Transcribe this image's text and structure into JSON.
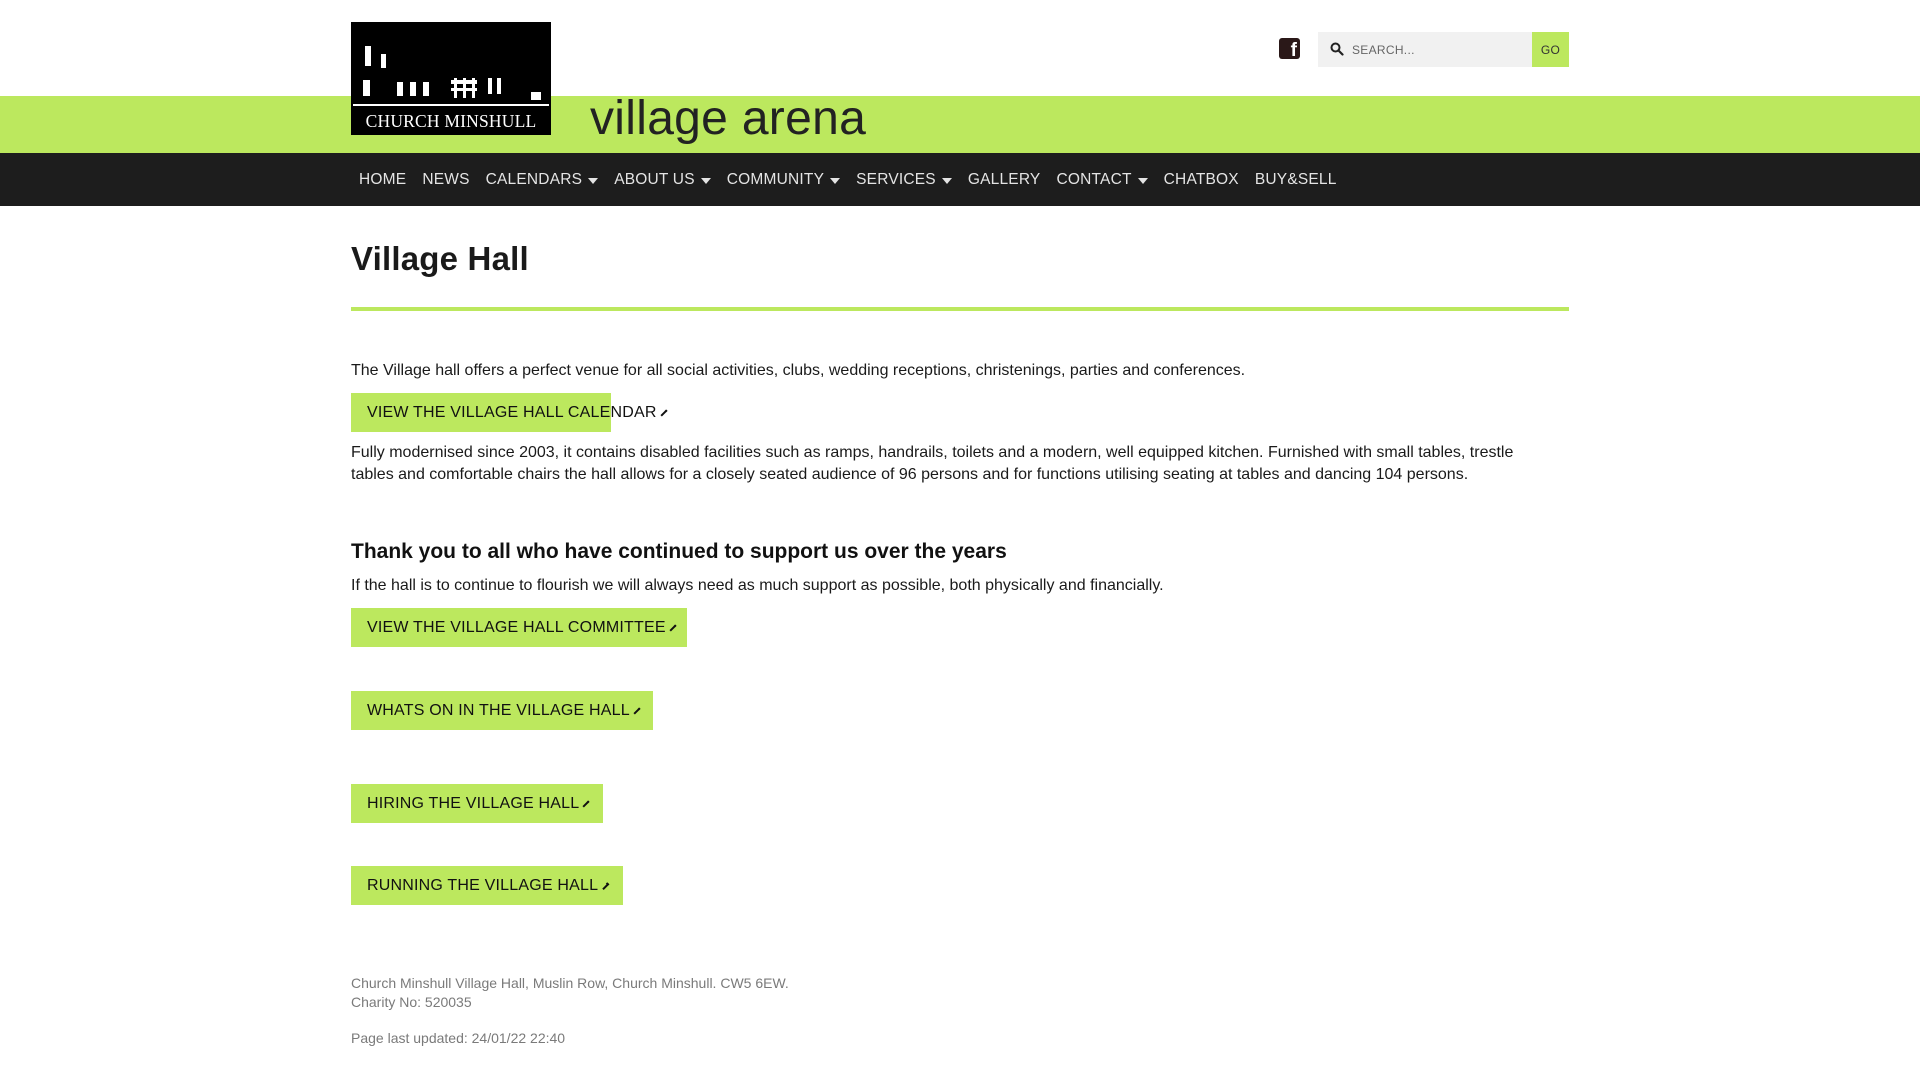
{
  "header": {
    "logo_text": "CHURCH MINSHULL",
    "site_name": "village arena",
    "search_placeholder": "SEARCH...",
    "go_label": "GO",
    "social_icon": "facebook-square-icon"
  },
  "nav": {
    "items": [
      {
        "label": "HOME",
        "dropdown": false
      },
      {
        "label": "NEWS",
        "dropdown": false
      },
      {
        "label": "CALENDARS",
        "dropdown": true
      },
      {
        "label": "ABOUT US",
        "dropdown": true
      },
      {
        "label": "COMMUNITY",
        "dropdown": true
      },
      {
        "label": "SERVICES",
        "dropdown": true
      },
      {
        "label": "GALLERY",
        "dropdown": false
      },
      {
        "label": "CONTACT",
        "dropdown": true
      },
      {
        "label": "CHATBOX",
        "dropdown": false
      },
      {
        "label": "BUY&SELL",
        "dropdown": false
      }
    ]
  },
  "main": {
    "title": "Village Hall",
    "intro": "The Village hall offers a perfect venue for all social activities, clubs, wedding receptions, christenings, parties and conferences.",
    "calendar_button": "VIEW THE VILLAGE HALL CALENDAR",
    "description": "Fully modernised since 2003, it contains disabled facilities such as ramps, handrails, toilets and a modern, well equipped kitchen. Furnished with small tables, trestle tables and comfortable chairs the hall allows for a closely seated audience of 96 persons and for functions utilising seating at tables and dancing 104 persons.",
    "thanks_heading": "Thank you to all who have continued to support us over the years",
    "support_text": "If the hall is to continue to flourish we will always need as much support as possible, both physically and financially.",
    "committee_button": "VIEW THE VILLAGE HALL COMMITTEE",
    "whats_on_button": "WHATS ON IN THE VILLAGE HALL",
    "hiring_button": "HIRING THE VILLAGE HALL",
    "running_button": "RUNNING THE VILLAGE HALL"
  },
  "footer": {
    "address": "Church Minshull Village Hall, Muslin Row, Church Minshull. CW5 6EW.",
    "charity": "Charity No: 520035",
    "updated": "Page last updated: 24/01/22 22:40"
  },
  "colors": {
    "accent": "#bce85e",
    "nav_bg": "#1d1d1d"
  }
}
